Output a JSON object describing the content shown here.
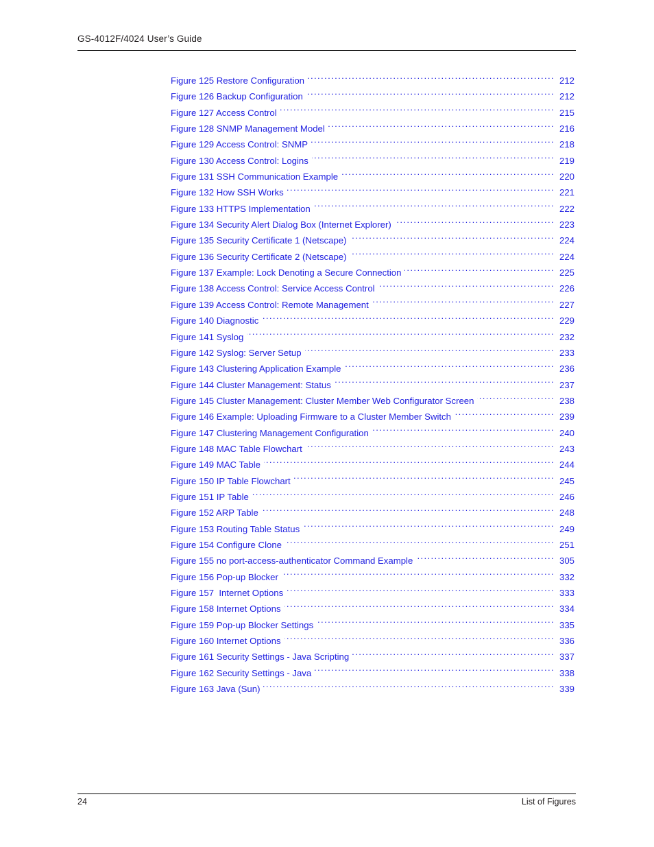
{
  "header": {
    "title": "GS-4012F/4024 User’s Guide"
  },
  "footer": {
    "page_number": "24",
    "section": "List of Figures"
  },
  "colors": {
    "link_blue": "#1f1fe0",
    "body_black": "#231f20",
    "rule_black": "#000000",
    "page_background": "#ffffff"
  },
  "list_of_figures": {
    "entries": [
      {
        "label": "Figure 125 Restore Configuration",
        "page": "212"
      },
      {
        "label": "Figure 126 Backup Configuration",
        "page": "212"
      },
      {
        "label": "Figure 127 Access Control",
        "page": "215"
      },
      {
        "label": "Figure 128 SNMP Management Model",
        "page": "216"
      },
      {
        "label": "Figure 129 Access Control: SNMP",
        "page": "218"
      },
      {
        "label": "Figure 130 Access Control: Logins",
        "page": "219"
      },
      {
        "label": "Figure 131 SSH Communication Example",
        "page": "220"
      },
      {
        "label": "Figure 132 How SSH Works",
        "page": "221"
      },
      {
        "label": "Figure 133 HTTPS Implementation",
        "page": "222"
      },
      {
        "label": "Figure 134 Security Alert Dialog Box (Internet Explorer)",
        "page": "223"
      },
      {
        "label": "Figure 135 Security Certificate 1 (Netscape)",
        "page": "224"
      },
      {
        "label": "Figure 136 Security Certificate 2 (Netscape)",
        "page": "224"
      },
      {
        "label": "Figure 137 Example: Lock Denoting a Secure Connection",
        "page": "225"
      },
      {
        "label": "Figure 138 Access Control: Service Access Control",
        "page": "226"
      },
      {
        "label": "Figure 139 Access Control: Remote Management",
        "page": "227"
      },
      {
        "label": "Figure 140 Diagnostic",
        "page": "229"
      },
      {
        "label": "Figure 141 Syslog",
        "page": "232"
      },
      {
        "label": "Figure 142 Syslog: Server Setup",
        "page": "233"
      },
      {
        "label": "Figure 143 Clustering Application Example",
        "page": "236"
      },
      {
        "label": "Figure 144 Cluster Management: Status",
        "page": "237"
      },
      {
        "label": "Figure 145 Cluster Management: Cluster Member Web Configurator Screen",
        "page": "238"
      },
      {
        "label": "Figure 146 Example: Uploading Firmware to a Cluster Member Switch",
        "page": "239"
      },
      {
        "label": "Figure 147 Clustering Management Configuration",
        "page": "240"
      },
      {
        "label": "Figure 148 MAC Table Flowchart",
        "page": "243"
      },
      {
        "label": "Figure 149 MAC Table",
        "page": "244"
      },
      {
        "label": "Figure 150 IP Table Flowchart",
        "page": "245"
      },
      {
        "label": "Figure 151 IP Table",
        "page": "246"
      },
      {
        "label": "Figure 152 ARP Table",
        "page": "248"
      },
      {
        "label": "Figure 153 Routing Table Status",
        "page": "249"
      },
      {
        "label": "Figure 154 Configure Clone",
        "page": "251"
      },
      {
        "label": "Figure 155 no port-access-authenticator Command Example",
        "page": "305"
      },
      {
        "label": "Figure 156 Pop-up Blocker",
        "page": "332"
      },
      {
        "label": "Figure 157  Internet Options",
        "page": "333"
      },
      {
        "label": "Figure 158 Internet Options",
        "page": "334"
      },
      {
        "label": "Figure 159 Pop-up Blocker Settings",
        "page": "335"
      },
      {
        "label": "Figure 160 Internet Options",
        "page": "336"
      },
      {
        "label": "Figure 161 Security Settings - Java Scripting",
        "page": "337"
      },
      {
        "label": "Figure 162 Security Settings - Java",
        "page": "338"
      },
      {
        "label": "Figure 163 Java (Sun)",
        "page": "339"
      }
    ]
  }
}
